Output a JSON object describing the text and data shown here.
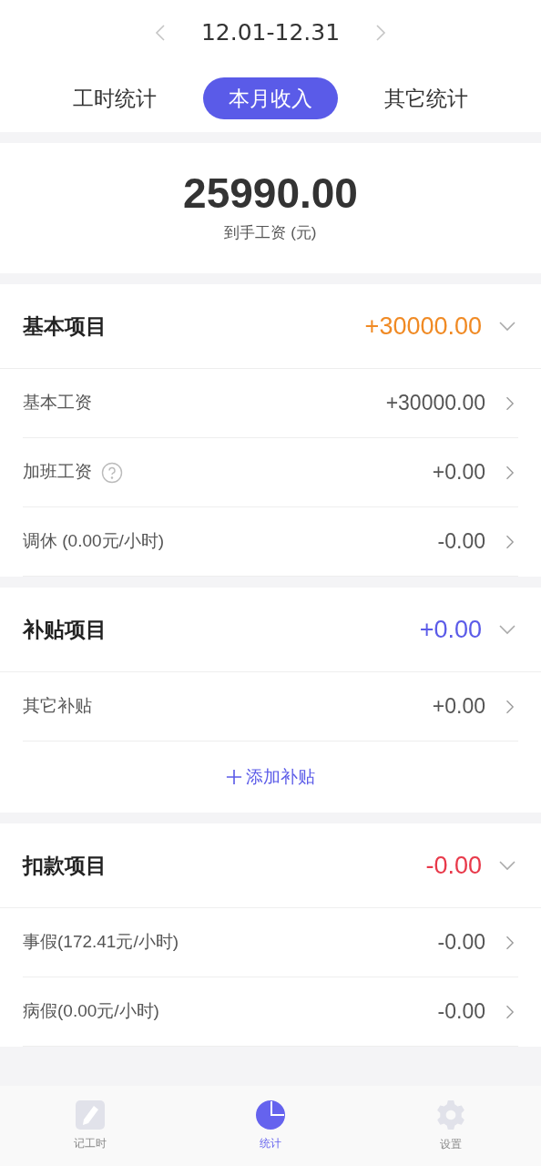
{
  "date_range": "12.01-12.31",
  "tabs": [
    {
      "label": "工时统计",
      "selected": false
    },
    {
      "label": "本月收入",
      "selected": true
    },
    {
      "label": "其它统计",
      "selected": false
    }
  ],
  "summary": {
    "amount": "25990.00",
    "caption": "到手工资 (元)"
  },
  "groups": [
    {
      "title": "基本项目",
      "total": "+30000.00",
      "color": "#f08a24",
      "expanded": true,
      "rows": [
        {
          "label": "基本工资",
          "value": "+30000.00",
          "help": false
        },
        {
          "label": "加班工资",
          "value": "+0.00",
          "help": true
        },
        {
          "label": "调休 (0.00元/小时)",
          "value": "-0.00",
          "help": false
        }
      ]
    },
    {
      "title": "补贴项目",
      "total": "+0.00",
      "color": "#5b5be8",
      "expanded": true,
      "rows": [
        {
          "label": "其它补贴",
          "value": "+0.00",
          "help": false
        }
      ],
      "add_button": "添加补贴"
    },
    {
      "title": "扣款项目",
      "total": "-0.00",
      "color": "#e8394a",
      "expanded": true,
      "rows": [
        {
          "label": "事假(172.41元/小时)",
          "value": "-0.00",
          "help": false
        },
        {
          "label": "病假(0.00元/小时)",
          "value": "-0.00",
          "help": false
        }
      ]
    }
  ],
  "bottom_nav": [
    {
      "label": "记工时",
      "kind": "pencil",
      "selected": false
    },
    {
      "label": "统计",
      "kind": "chart",
      "selected": true
    },
    {
      "label": "设置",
      "kind": "gear",
      "selected": false
    }
  ]
}
